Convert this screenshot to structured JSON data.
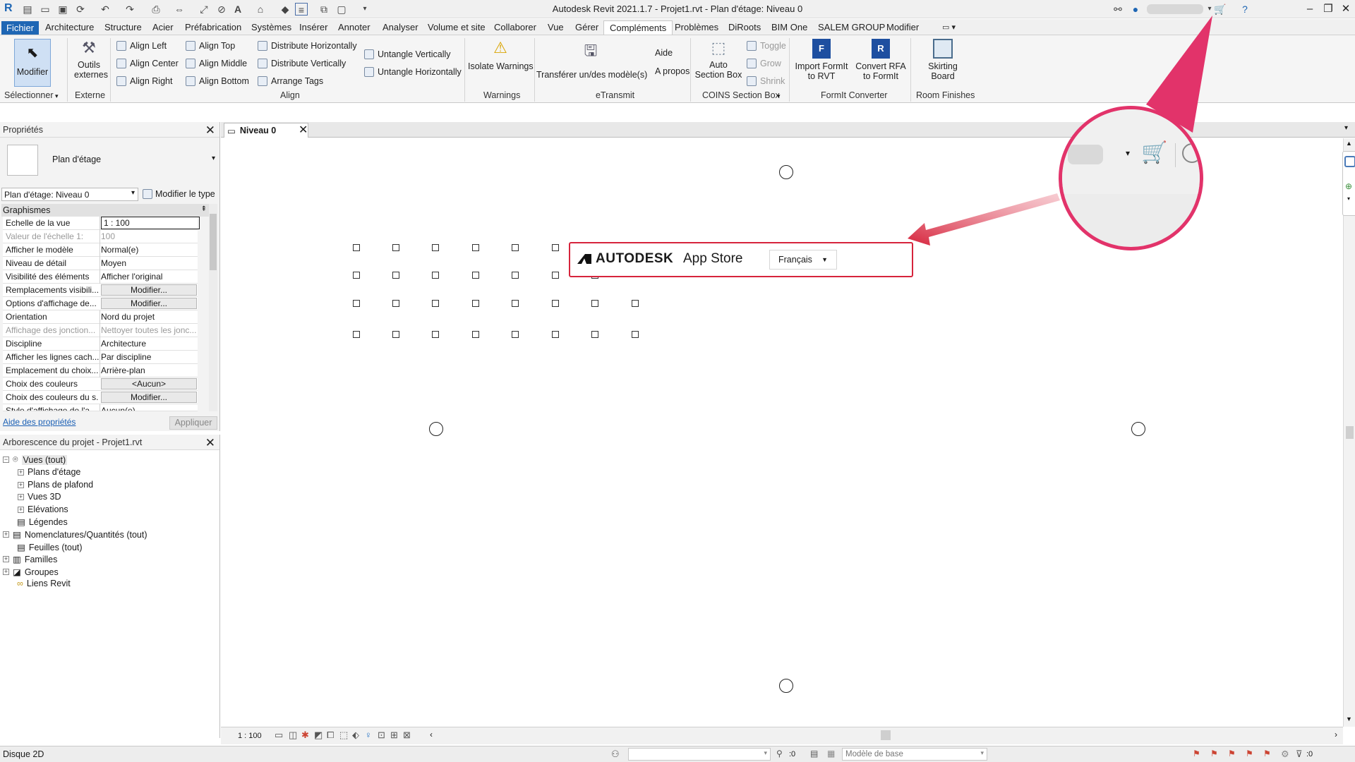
{
  "title": "Autodesk Revit 2021.1.7 - Projet1.rvt - Plan d'étage: Niveau 0",
  "menu_tabs": [
    "Fichier",
    "Architecture",
    "Structure",
    "Acier",
    "Préfabrication",
    "Systèmes",
    "Insérer",
    "Annoter",
    "Analyser",
    "Volume et site",
    "Collaborer",
    "Vue",
    "Gérer",
    "Compléments",
    "Problèmes",
    "DiRoots",
    "BIM One",
    "SALEM GROUP",
    "Modifier"
  ],
  "ribbon": {
    "modifier": "Modifier",
    "outils1": "Outils",
    "outils2": "externes",
    "align_left": "Align Left",
    "align_center": "Align Center",
    "align_right": "Align Right",
    "align_top": "Align Top",
    "align_middle": "Align Middle",
    "align_bottom": "Align Bottom",
    "dist_h": "Distribute Horizontally",
    "dist_v": "Distribute Vertically",
    "arrange_tags": "Arrange Tags",
    "untangle_v": "Untangle Vertically",
    "untangle_h": "Untangle Horizontally",
    "isolate": "Isolate Warnings",
    "transferer": "Transférer un/des modèle(s)",
    "aide": "Aide",
    "apropos": "A propos",
    "auto1": "Auto",
    "auto2": "Section Box",
    "toggle": "Toggle",
    "grow": "Grow",
    "shrink": "Shrink",
    "imp1": "Import FormIt",
    "imp2": "to RVT",
    "conv1": "Convert RFA",
    "conv2": "to FormIt",
    "sk1": "Skirting",
    "sk2": "Board",
    "groups": {
      "selectionner": "Sélectionner",
      "externe": "Externe",
      "align": "Align",
      "warnings": "Warnings",
      "etransmit": "eTransmit",
      "coins": "COINS Section Box",
      "formit": "FormIt Converter",
      "room": "Room Finishes"
    }
  },
  "properties": {
    "header": "Propriétés",
    "type_name": "Plan d'étage",
    "selector": "Plan d'étage: Niveau 0",
    "edit_type": "Modifier le type",
    "section": "Graphismes",
    "rows": [
      {
        "k": "Echelle de la vue",
        "v": "1 : 100"
      },
      {
        "k": "Valeur de l'échelle    1:",
        "v": "100"
      },
      {
        "k": "Afficher le modèle",
        "v": "Normal(e)"
      },
      {
        "k": "Niveau de détail",
        "v": "Moyen"
      },
      {
        "k": "Visibilité des éléments",
        "v": "Afficher l'original"
      },
      {
        "k": "Remplacements visibili...",
        "v": "Modifier..."
      },
      {
        "k": "Options d'affichage de...",
        "v": "Modifier..."
      },
      {
        "k": "Orientation",
        "v": "Nord du projet"
      },
      {
        "k": "Affichage des jonction...",
        "v": "Nettoyer toutes les jonc..."
      },
      {
        "k": "Discipline",
        "v": "Architecture"
      },
      {
        "k": "Afficher les lignes cach...",
        "v": "Par discipline"
      },
      {
        "k": "Emplacement du choix...",
        "v": "Arrière-plan"
      },
      {
        "k": "Choix des couleurs",
        "v": "<Aucun>"
      },
      {
        "k": "Choix des couleurs du s...",
        "v": "Modifier..."
      },
      {
        "k": "Style d'affichage de l'a...",
        "v": "Aucun(e)"
      }
    ],
    "help_link": "Aide des propriétés",
    "apply": "Appliquer"
  },
  "tree": {
    "header": "Arborescence du projet - Projet1.rvt",
    "nodes": [
      "Vues (tout)",
      "Plans d'étage",
      "Plans de plafond",
      "Vues 3D",
      "Elévations",
      "Légendes",
      "Nomenclatures/Quantités (tout)",
      "Feuilles (tout)",
      "Familles",
      "Groupes",
      "Liens Revit"
    ]
  },
  "view_tab": "Niveau 0",
  "app_store": {
    "brand": "AUTODESK",
    "product": "App Store",
    "language": "Français"
  },
  "view_scale": "1 : 100",
  "status": {
    "left": "Disque 2D",
    "coord": ":0",
    "model": "Modèle de base",
    "filter": ":0"
  },
  "colors": {
    "accent": "#1e66b4",
    "callout": "#e2336a",
    "box_border": "#d6243c"
  }
}
